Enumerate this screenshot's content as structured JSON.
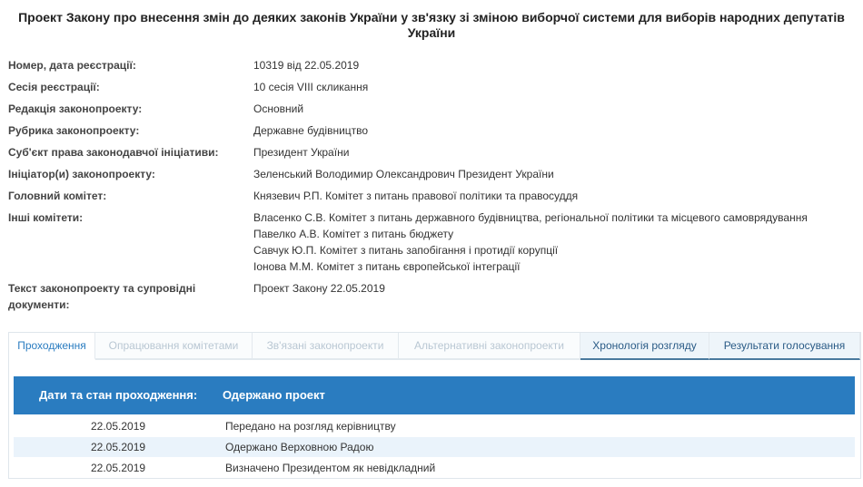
{
  "title": "Проект Закону про внесення змін до деяких законів України у зв'язку зі зміною виборчої системи для виборів народних депутатів України",
  "fields": [
    {
      "label": "Номер, дата реєстрації:",
      "values": [
        "10319 від 22.05.2019"
      ]
    },
    {
      "label": "Сесія реєстрації:",
      "values": [
        "10 сесія VIII скликання"
      ]
    },
    {
      "label": "Редакція законопроекту:",
      "values": [
        "Основний"
      ]
    },
    {
      "label": "Рубрика законопроекту:",
      "values": [
        "Державне будівництво"
      ]
    },
    {
      "label": "Суб'єкт права законодавчої ініціативи:",
      "values": [
        "Президент України"
      ]
    },
    {
      "label": "Ініціатор(и) законопроекту:",
      "values": [
        "Зеленський Володимир Олександрович Президент України"
      ]
    },
    {
      "label": "Головний комітет:",
      "values": [
        "Князевич Р.П. Комітет з питань правової політики та правосуддя"
      ]
    },
    {
      "label": "Інші комітети:",
      "values": [
        "Власенко С.В. Комітет з питань державного будівництва, регіональної політики та місцевого самоврядування",
        "Павелко А.В. Комітет з питань бюджету",
        "Савчук Ю.П. Комітет з питань запобігання і протидії корупції",
        "Іонова М.М. Комітет з питань європейської інтеграції"
      ]
    },
    {
      "label": "Текст законопроекту та супровідні документи:",
      "values": [
        "Проект Закону 22.05.2019"
      ]
    }
  ],
  "tabs": [
    {
      "label": "Проходження",
      "state": "active"
    },
    {
      "label": "Опрацювання комітетами",
      "state": "disabled"
    },
    {
      "label": "Зв'язані законопроекти",
      "state": "disabled"
    },
    {
      "label": "Альтернативні законопроекти",
      "state": "disabled"
    },
    {
      "label": "Хронологія розгляду",
      "state": "dark"
    },
    {
      "label": "Результати голосування",
      "state": "dark"
    }
  ],
  "table": {
    "header_label": "Дати та стан проходження:",
    "header_status": "Одержано проект",
    "rows": [
      {
        "date": "22.05.2019",
        "status": "Передано на розгляд керівництву"
      },
      {
        "date": "22.05.2019",
        "status": "Одержано Верховною Радою"
      },
      {
        "date": "22.05.2019",
        "status": "Визначено Президентом як невідкладний"
      }
    ]
  },
  "colors": {
    "accent": "#2a7cc0",
    "row_alt": "#eaf3fb"
  }
}
